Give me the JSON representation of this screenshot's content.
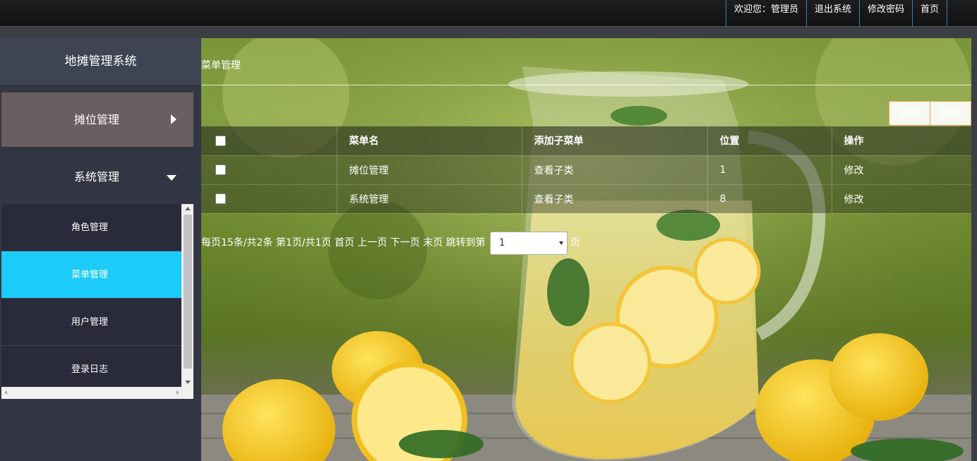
{
  "topbar": {
    "welcome": "欢迎您：管理员",
    "logout": "退出系统",
    "change_password": "修改密码",
    "home": "首页"
  },
  "sidebar": {
    "title": "地摊管理系统",
    "groups": [
      {
        "label": "摊位管理",
        "expanded": false
      },
      {
        "label": "系统管理",
        "expanded": true
      }
    ],
    "sub_items": [
      {
        "label": "角色管理"
      },
      {
        "label": "菜单管理",
        "active": true
      },
      {
        "label": "用户管理"
      },
      {
        "label": "登录日志"
      }
    ]
  },
  "main": {
    "breadcrumb": "菜单管理",
    "buttons": {
      "add": "添加",
      "delete": "删除"
    },
    "table": {
      "headers": [
        "菜单名",
        "添加子菜单",
        "位置",
        "操作"
      ],
      "rows": [
        {
          "name": "摊位管理",
          "sub": "查看子类",
          "position": "1",
          "action": "修改"
        },
        {
          "name": "系统管理",
          "sub": "查看子类",
          "position": "8",
          "action": "修改"
        }
      ]
    },
    "pager": {
      "summary": "每页15条/共2条 第1页/共1页",
      "first": "首页",
      "prev": "上一页",
      "next": "下一页",
      "last": "末页",
      "jump_label": "跳转到第",
      "jump_value": "1",
      "page_suffix": "页"
    }
  },
  "colors": {
    "active_item": "#1ccbf7",
    "expanded_group": "#6a5e60",
    "sidebar_bg": "#333743",
    "submenu_bg": "#292b3a"
  }
}
